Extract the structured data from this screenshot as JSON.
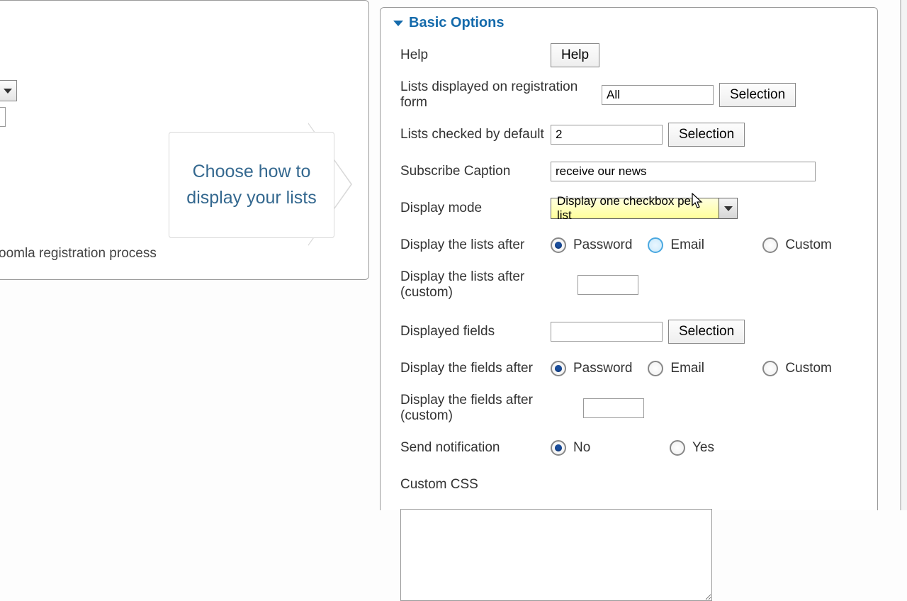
{
  "left": {
    "caption": "oomla registration process"
  },
  "callout": {
    "line1": "Choose how to",
    "line2": "display your lists"
  },
  "panel": {
    "title": "Basic Options"
  },
  "form": {
    "help_label": "Help",
    "help_button": "Help",
    "lists_reg_label": "Lists displayed on registration form",
    "lists_reg_value": "All",
    "lists_checked_label": "Lists checked by default",
    "lists_checked_value": "2",
    "subscribe_caption_label": "Subscribe Caption",
    "subscribe_caption_value": "receive our news",
    "display_mode_label": "Display mode",
    "display_mode_value": "Display one checkbox per list",
    "display_lists_after_label": "Display the lists after",
    "display_lists_after_custom_label": "Display the lists after (custom)",
    "display_lists_after_custom_value": "",
    "displayed_fields_label": "Displayed fields",
    "displayed_fields_value": "",
    "display_fields_after_label": "Display the fields after",
    "display_fields_after_custom_label": "Display the fields after (custom)",
    "display_fields_after_custom_value": "",
    "send_notification_label": "Send notification",
    "custom_css_label": "Custom CSS",
    "selection_button": "Selection",
    "radios": {
      "password": "Password",
      "email": "Email",
      "custom": "Custom",
      "no": "No",
      "yes": "Yes"
    }
  }
}
